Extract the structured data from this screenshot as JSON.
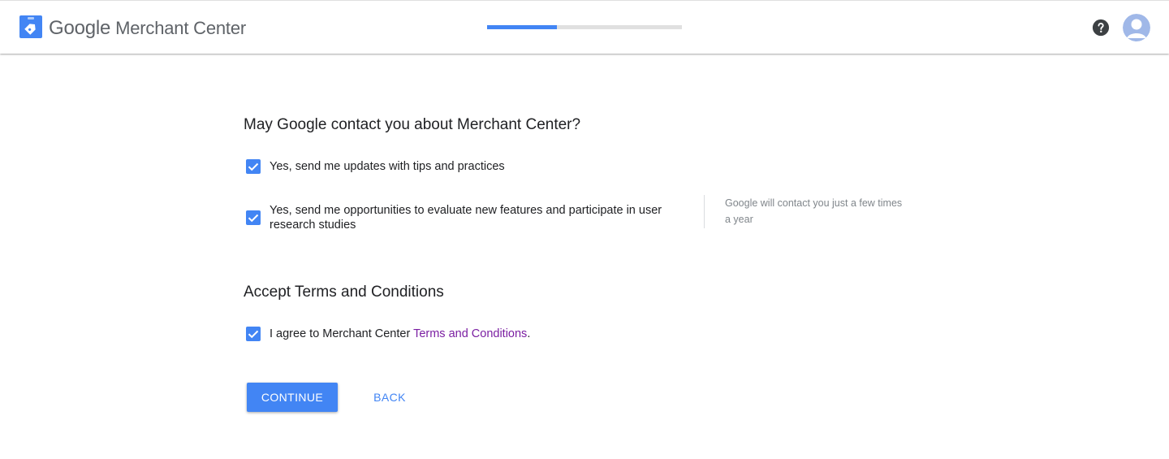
{
  "header": {
    "brand_google": "Google",
    "brand_product": "Merchant Center",
    "progress_fraction": 0.36,
    "accent_color": "#4285f4",
    "help_icon": "help-circle-icon",
    "avatar_icon": "account-avatar-icon"
  },
  "contact": {
    "title": "May Google contact you about Merchant Center?",
    "options": [
      {
        "label": "Yes, send me updates with tips and practices",
        "checked": true
      },
      {
        "label_line1": "Yes, send me opportunities to evaluate new features and participate in user",
        "label_line2": "research studies",
        "checked": true
      }
    ],
    "note_line1": "Google will contact you just a few times",
    "note_line2": "a year"
  },
  "terms": {
    "title": "Accept Terms and Conditions",
    "agree_prefix": "I agree to Merchant Center ",
    "agree_link": "Terms and Conditions",
    "agree_suffix": ".",
    "checked": true,
    "link_color": "#7b1fa2"
  },
  "actions": {
    "continue_label": "CONTINUE",
    "back_label": "BACK"
  }
}
